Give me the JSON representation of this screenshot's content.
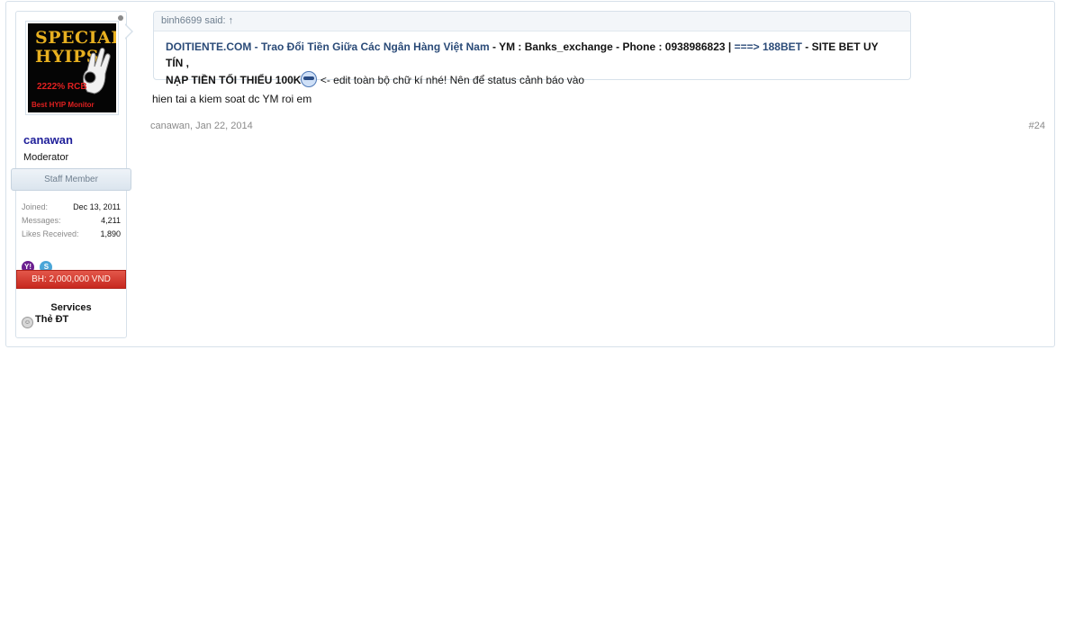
{
  "user": {
    "name": "canawan",
    "title": "Moderator",
    "staff_label": "Staff Member",
    "avatar": {
      "line1": "SPECIAL",
      "line2": "HYIPS",
      "percent": "2222% RCB",
      "caption": "Best HYIP Monitor"
    },
    "stats": [
      {
        "label": "Joined:",
        "value": "Dec 13, 2011"
      },
      {
        "label": "Messages:",
        "value": "4,211"
      },
      {
        "label": "Likes Received:",
        "value": "1,890"
      }
    ],
    "im": {
      "yahoo": "Y!",
      "skype": "S"
    },
    "banner": "BH: 2,000,000 VND",
    "services_title": "Services",
    "service_item": "Thẻ ĐT"
  },
  "quote": {
    "header": "binh6699 said: ↑",
    "link1": "DOITIENTE.COM - Trao Đổi Tiền Giữa Các Ngân Hàng Việt Nam",
    "sep1": " - ",
    "text1": "YM : Banks_exchange - Phone : 0938986823 | ",
    "link2": "===> 188BET",
    "text2": " - SITE BET UY TÍN ,",
    "text3": "NẠP TIỀN TỐI THIỂU 100K",
    "text4": " <- edit toàn bộ chữ kí nhé! Nên để status cảnh báo vào"
  },
  "post": {
    "message": "hien tai a kiem soat dc YM roi em",
    "author_date": "canawan, Jan 22, 2014",
    "permalink": "#24"
  },
  "colors": {
    "username": "#20209a",
    "quote_link": "#2b4b78",
    "banner": "#c7281f",
    "border": "#d7e1ea"
  }
}
